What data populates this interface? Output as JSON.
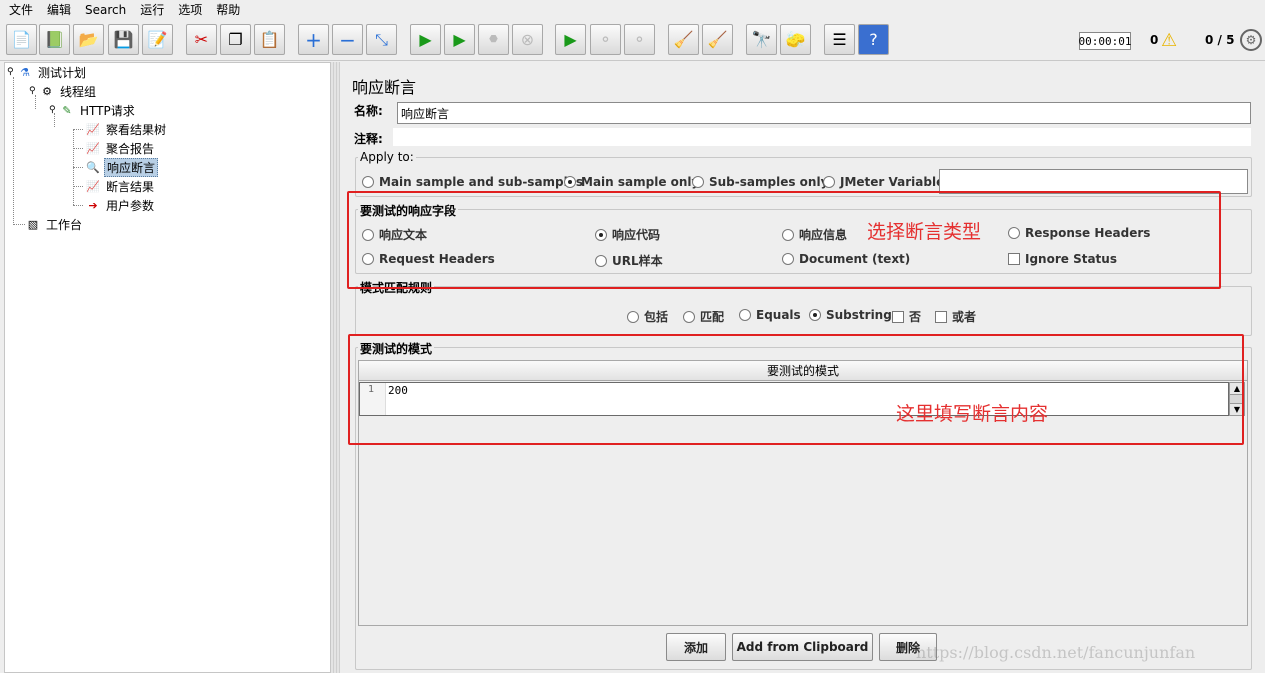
{
  "menu": [
    "文件",
    "编辑",
    "Search",
    "运行",
    "选项",
    "帮助"
  ],
  "toolbar": {
    "timer": "00:00:01",
    "warnings": "0",
    "threads": "0 / 5"
  },
  "tree": {
    "plan": "测试计划",
    "group": "线程组",
    "http": "HTTP请求",
    "viewer": "察看结果树",
    "agg": "聚合报告",
    "assert": "响应断言",
    "assert_result": "断言结果",
    "params": "用户参数",
    "workbench": "工作台"
  },
  "panel": {
    "title": "响应断言",
    "name_label": "名称:",
    "name_value": "响应断言",
    "comment_label": "注释:",
    "apply_to": "Apply to:",
    "apply_options": [
      "Main sample and sub-samples",
      "Main sample only",
      "Sub-samples only",
      "JMeter Variable"
    ],
    "field_section": "要测试的响应字段",
    "fields": [
      "响应文本",
      "响应代码",
      "响应信息",
      "Response Headers",
      "Request Headers",
      "URL样本",
      "Document (text)",
      "Ignore Status"
    ],
    "pattern_rules_section": "模式匹配规则",
    "rules": [
      "包括",
      "匹配",
      "Equals",
      "Substring",
      "否",
      "或者"
    ],
    "patterns_section": "要测试的模式",
    "table_header": "要测试的模式",
    "row_number": "1",
    "row_value": "200",
    "buttons": {
      "add": "添加",
      "clipboard": "Add from Clipboard",
      "delete": "删除"
    }
  },
  "annotations": {
    "type": "选择断言类型",
    "content": "这里填写断言内容"
  },
  "watermark": "https://blog.csdn.net/fancunjunfan",
  "colors": {
    "annotation": "#e53030",
    "selection": "#b8cfe5"
  }
}
